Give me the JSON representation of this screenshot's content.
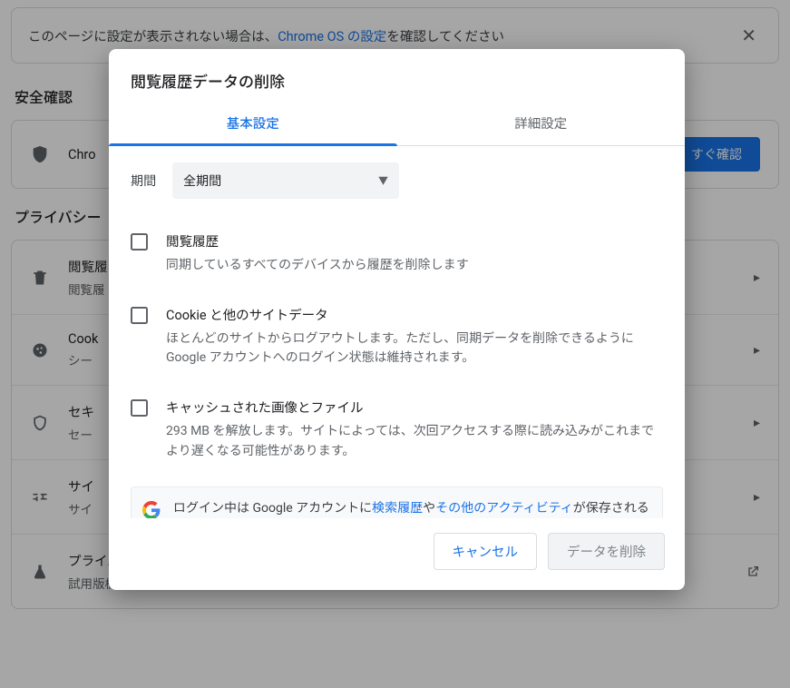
{
  "banner": {
    "pre_text": "このページに設定が表示されない場合は、",
    "link_text": "Chrome OS の設定",
    "post_text": "を確認してください"
  },
  "sections": {
    "safety_heading": "安全確認",
    "safety_row_text": "Chro",
    "safety_action": "すぐ確認",
    "privacy_heading": "プライバシー"
  },
  "rows": {
    "history": {
      "title": "閲覧履",
      "sub": "閲覧履"
    },
    "cookies": {
      "title": "Cook",
      "sub": "シー"
    },
    "security": {
      "title": "セキ",
      "sub": "セー"
    },
    "site": {
      "title": "サイ",
      "sub": "サイ"
    },
    "sandbox": {
      "title": "プライバシー サンドボックス",
      "sub": "試用版機能はオンになっています"
    }
  },
  "dialog": {
    "title": "閲覧履歴データの削除",
    "tab_basic": "基本設定",
    "tab_advanced": "詳細設定",
    "time_label": "期間",
    "time_value": "全期間",
    "items": {
      "history": {
        "title": "閲覧履歴",
        "desc": "同期しているすべてのデバイスから履歴を削除します"
      },
      "cookies": {
        "title": "Cookie と他のサイトデータ",
        "desc": "ほとんどのサイトからログアウトします。ただし、同期データを削除できるように Google アカウントへのログイン状態は維持されます。"
      },
      "cache": {
        "title": "キャッシュされた画像とファイル",
        "desc": "293 MB を解放します。サイトによっては、次回アクセスする際に読み込みがこれまでより遅くなる可能性があります。"
      }
    },
    "note": {
      "pre": "ログイン中は Google アカウントに",
      "link1": "検索履歴",
      "mid": "や",
      "link2": "その他のアクティビティ",
      "post": "が保存される可能性があります。これらのデータはいつでも削除できま"
    },
    "cancel": "キャンセル",
    "clear": "データを削除"
  }
}
